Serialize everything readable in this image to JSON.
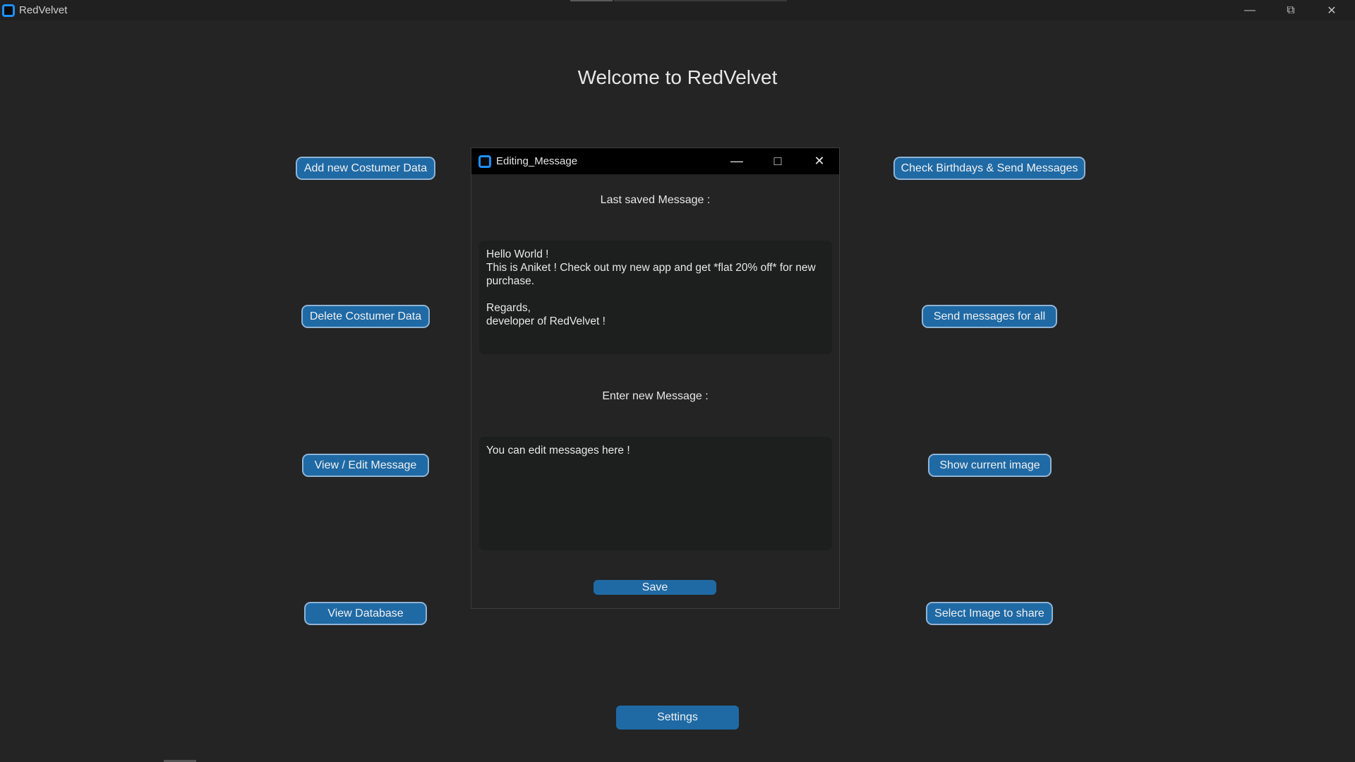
{
  "window": {
    "title": "RedVelvet"
  },
  "main": {
    "welcome": "Welcome to RedVelvet",
    "left_buttons": [
      "Add new Costumer Data",
      "Delete Costumer Data",
      "View / Edit Message",
      "View Database"
    ],
    "right_buttons": [
      "Check Birthdays & Send Messages",
      "Send messages for all",
      "Show current image",
      "Select Image to share"
    ],
    "settings_label": "Settings"
  },
  "dialog": {
    "title": "Editing_Message",
    "last_saved_label": "Last saved Message :",
    "last_saved_message": "Hello World !\nThis is Aniket ! Check out my new app and get *flat 20% off* for new purchase.\n\nRegards,\ndeveloper of RedVelvet !",
    "new_message_label": "Enter new Message :",
    "new_message_value": "You can edit messages here !",
    "save_label": "Save"
  },
  "colors": {
    "accent": "#1f6aa5",
    "background": "#242424",
    "icon": "#1e90ff"
  }
}
